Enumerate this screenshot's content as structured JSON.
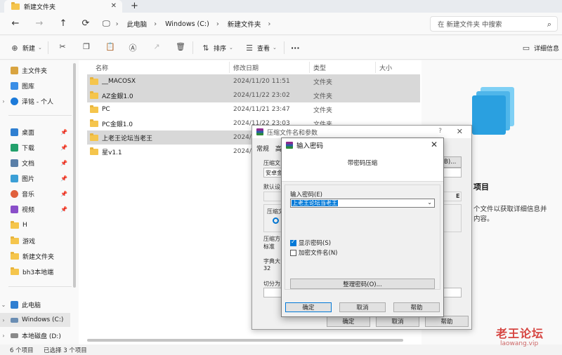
{
  "tab": {
    "title": "新建文件夹",
    "close": "✕",
    "add": "+"
  },
  "nav": {
    "back": "←",
    "forward": "→",
    "up": "↑",
    "refresh": "⟳",
    "breadcrumb": [
      "此电脑",
      "Windows (C:)",
      "新建文件夹"
    ],
    "search_placeholder": "在 新建文件夹 中搜索"
  },
  "toolbar": {
    "new_label": "新建",
    "sort_label": "排序",
    "view_label": "查看",
    "more": "···",
    "details_label": "详细信息"
  },
  "sidebar": {
    "items": [
      {
        "label": "主文件夹",
        "icon": "home-icon"
      },
      {
        "label": "图库",
        "icon": "gallery-icon"
      },
      {
        "label": "泽铭 - 个人",
        "icon": "cloud-icon"
      },
      {
        "label": "桌面",
        "icon": "desktop-icon"
      },
      {
        "label": "下载",
        "icon": "download-icon"
      },
      {
        "label": "文档",
        "icon": "document-icon"
      },
      {
        "label": "图片",
        "icon": "pictures-icon"
      },
      {
        "label": "音乐",
        "icon": "music-icon"
      },
      {
        "label": "视频",
        "icon": "video-icon"
      },
      {
        "label": "H",
        "icon": "folder-icon"
      },
      {
        "label": "游戏",
        "icon": "folder-icon"
      },
      {
        "label": "新建文件夹",
        "icon": "folder-icon"
      },
      {
        "label": "bh3本地端",
        "icon": "folder-icon"
      },
      {
        "label": "此电脑",
        "icon": "pc-icon"
      },
      {
        "label": "Windows (C:)",
        "icon": "drive-icon"
      },
      {
        "label": "本地磁盘 (D:)",
        "icon": "drive-icon"
      }
    ]
  },
  "files": {
    "columns": [
      "名称",
      "修改日期",
      "类型",
      "大小"
    ],
    "rows": [
      {
        "name": "__MACOSX",
        "date": "2024/11/20 11:51",
        "type": "文件夹",
        "selected": true
      },
      {
        "name": "AZ金銀1.0",
        "date": "2024/11/22 23:02",
        "type": "文件夹",
        "selected": true
      },
      {
        "name": "PC",
        "date": "2024/11/21 23:47",
        "type": "文件夹",
        "selected": false
      },
      {
        "name": "PC金銀1.0",
        "date": "2024/11/22 23:03",
        "type": "文件夹",
        "selected": false
      },
      {
        "name": "上老王论坛当老王",
        "date": "2024/",
        "type": "",
        "selected": true
      },
      {
        "name": "星v1.1",
        "date": "2024/",
        "type": "",
        "selected": false
      }
    ]
  },
  "preview": {
    "title": "项目",
    "desc_line1": "个文件以获取详细信息并",
    "desc_line2": "内容。"
  },
  "status": {
    "count": "6 个项目",
    "selected": "已选择 3 个项目"
  },
  "watermark": {
    "main": "老王论坛",
    "sub": "laowang.vip"
  },
  "compress_dialog": {
    "title": "压缩文件名和参数",
    "help": "?",
    "tab": "常规",
    "tab2": "高",
    "field1_label": "压缩文",
    "field1_value": "安卓金",
    "browse": "(B)...",
    "label2": "默认设",
    "label3": "压缩文",
    "label4": "压缩方",
    "field4_value": "标准",
    "label5": "字典大",
    "field5_value": "32",
    "label6": "切分为",
    "ok": "确定",
    "cancel": "取消",
    "help_btn": "帮助",
    "right_letter": "E"
  },
  "password_dialog": {
    "title": "输入密码",
    "header": "带密码压缩",
    "label": "输入密码(E)",
    "value": "上老王论坛当老王",
    "show_password": "显示密码(S)",
    "encrypt_names": "加密文件名(N)",
    "organize": "整理密码(O)...",
    "ok": "确定",
    "cancel": "取消",
    "help": "帮助"
  }
}
